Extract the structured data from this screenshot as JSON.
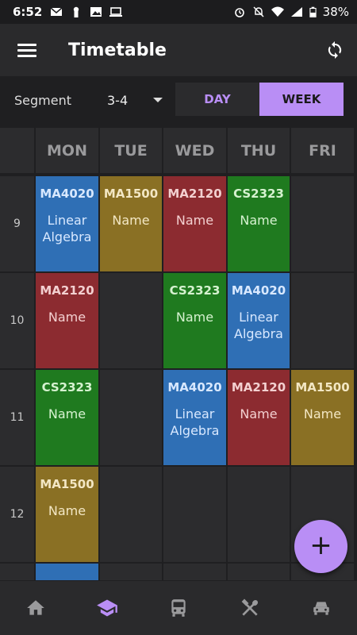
{
  "status_bar": {
    "time": "6:52",
    "battery": "38%",
    "left_icons": [
      "mail-icon",
      "keyhole-icon",
      "image-icon",
      "laptop-icon"
    ],
    "right_icons": [
      "alarm-icon",
      "bell-off-icon",
      "wifi-icon",
      "signal-icon",
      "battery-icon"
    ]
  },
  "app_bar": {
    "title": "Timetable",
    "menu_icon": "menu-icon",
    "sync_icon": "sync-icon"
  },
  "controls": {
    "segment_label": "Segment",
    "segment_value": "3-4",
    "toggle": {
      "day": "DAY",
      "week": "WEEK",
      "selected": "WEEK"
    }
  },
  "timetable": {
    "days": [
      "MON",
      "TUE",
      "WED",
      "THU",
      "FRI"
    ],
    "times": [
      "9",
      "10",
      "11",
      "12"
    ],
    "courses": [
      {
        "day": 0,
        "slot": 0,
        "code": "MA4020",
        "name": "Linear Algebra",
        "color": "#2f6fb5"
      },
      {
        "day": 1,
        "slot": 0,
        "code": "MA1500",
        "name": "Name",
        "color": "#8a7024"
      },
      {
        "day": 2,
        "slot": 0,
        "code": "MA2120",
        "name": "Name",
        "color": "#8c2b30"
      },
      {
        "day": 3,
        "slot": 0,
        "code": "CS2323",
        "name": "Name",
        "color": "#1f7a1f"
      },
      {
        "day": 0,
        "slot": 1,
        "code": "MA2120",
        "name": "Name",
        "color": "#8c2b30"
      },
      {
        "day": 2,
        "slot": 1,
        "code": "CS2323",
        "name": "Name",
        "color": "#1f7a1f"
      },
      {
        "day": 3,
        "slot": 1,
        "code": "MA4020",
        "name": "Linear Algebra",
        "color": "#2f6fb5"
      },
      {
        "day": 0,
        "slot": 2,
        "code": "CS2323",
        "name": "Name",
        "color": "#1f7a1f"
      },
      {
        "day": 2,
        "slot": 2,
        "code": "MA4020",
        "name": "Linear Algebra",
        "color": "#2f6fb5"
      },
      {
        "day": 3,
        "slot": 2,
        "code": "MA2120",
        "name": "Name",
        "color": "#8c2b30"
      },
      {
        "day": 4,
        "slot": 2,
        "code": "MA1500",
        "name": "Name",
        "color": "#8a7024"
      },
      {
        "day": 0,
        "slot": 3,
        "code": "MA1500",
        "name": "Name",
        "color": "#8a7024"
      },
      {
        "day": 0,
        "slot": 4,
        "code": "",
        "name": "",
        "color": "#2f6fb5"
      }
    ]
  },
  "fab": {
    "label": "+"
  },
  "bottom_nav": {
    "items": [
      {
        "icon": "home-icon",
        "active": false
      },
      {
        "icon": "graduation-cap-icon",
        "active": true
      },
      {
        "icon": "bus-icon",
        "active": false
      },
      {
        "icon": "fork-spoon-icon",
        "active": false
      },
      {
        "icon": "car-icon",
        "active": false
      }
    ]
  },
  "colors": {
    "accent": "#b98ef5",
    "background": "#1f1f21",
    "cell": "#2c2c2e"
  }
}
